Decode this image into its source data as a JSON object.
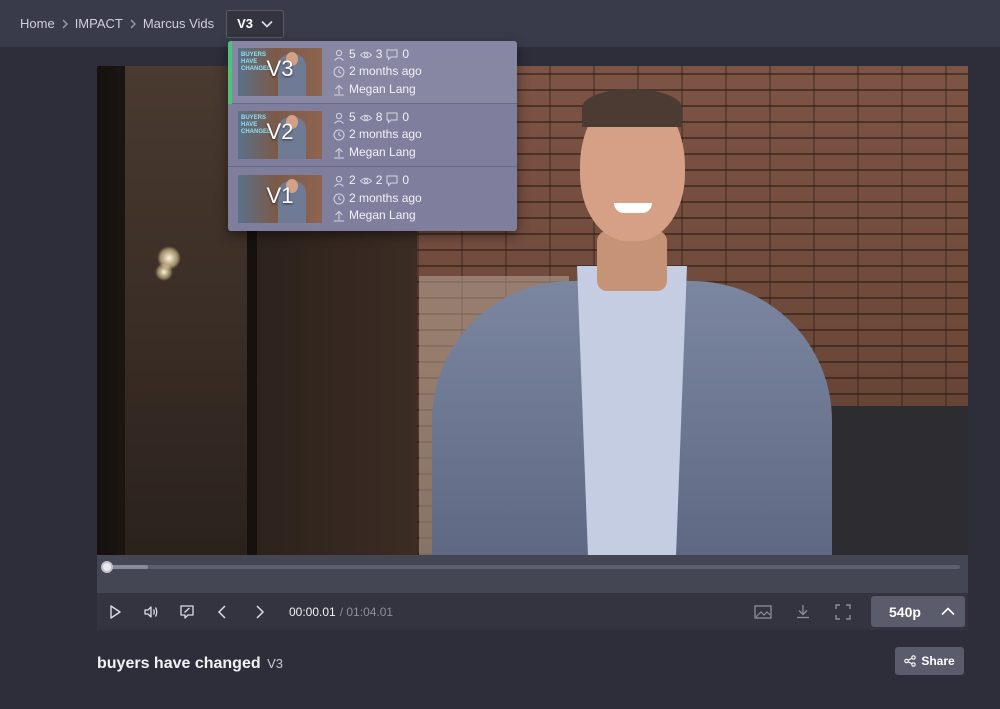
{
  "breadcrumb": {
    "items": [
      "Home",
      "IMPACT",
      "Marcus Vids"
    ],
    "current_version": "V3"
  },
  "versions": [
    {
      "label": "V3",
      "reviewers": "5",
      "views": "3",
      "comments": "0",
      "time": "2 months ago",
      "uploader": "Megan Lang",
      "thumb_text": "BUYERS HAVE CHANGED",
      "active": true
    },
    {
      "label": "V2",
      "reviewers": "5",
      "views": "8",
      "comments": "0",
      "time": "2 months ago",
      "uploader": "Megan Lang",
      "thumb_text": "BUYERS HAVE CHANGED",
      "active": false
    },
    {
      "label": "V1",
      "reviewers": "2",
      "views": "2",
      "comments": "0",
      "time": "2 months ago",
      "uploader": "Megan Lang",
      "thumb_text": "",
      "active": false
    }
  ],
  "player": {
    "current_time": "00:00.01",
    "total_time": "/ 01:04.01",
    "quality": "540p",
    "progress": 0.0,
    "buffered": 0.05
  },
  "video_info": {
    "title": "buyers have changed",
    "version": "V3",
    "share_label": "Share"
  },
  "colors": {
    "active_indicator": "#4fc27a",
    "dropdown_bg": "#7f7f9d",
    "topbar_bg": "#3a3b4a",
    "page_bg": "#2e2e3a"
  },
  "icons": [
    "chevron-right-icon",
    "chevron-down-icon",
    "reviewer-icon",
    "eye-icon",
    "comment-icon",
    "clock-icon",
    "upload-icon",
    "play-icon",
    "volume-icon",
    "annotate-icon",
    "prev-frame-icon",
    "next-frame-icon",
    "image-icon",
    "download-icon",
    "fullscreen-icon",
    "chevron-up-icon",
    "share-icon"
  ]
}
